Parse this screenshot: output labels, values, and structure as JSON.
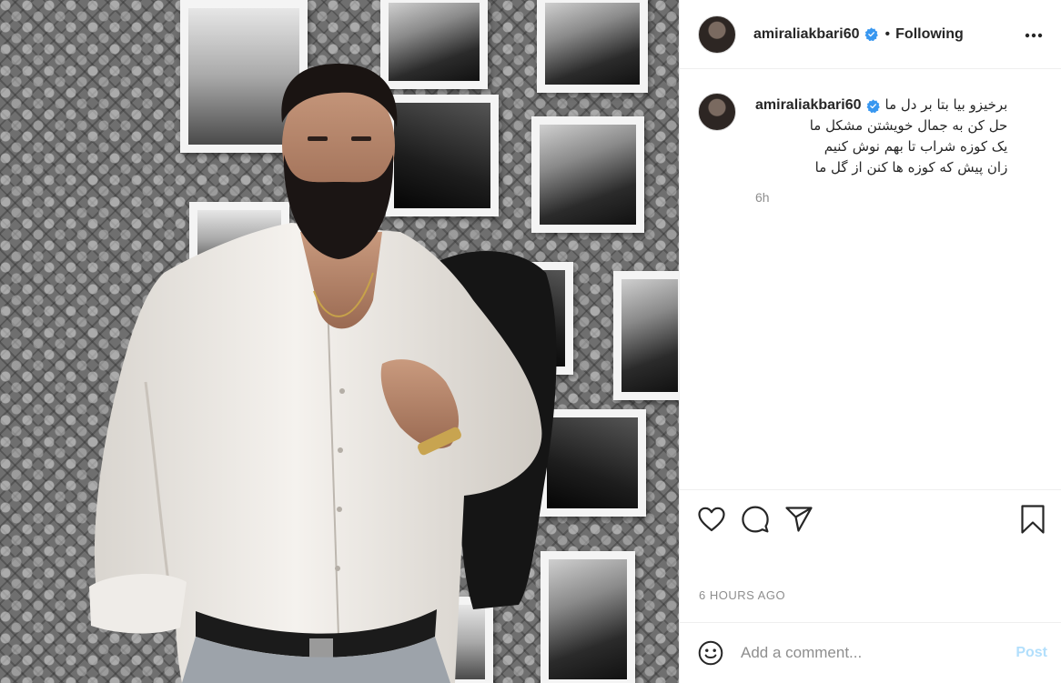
{
  "post": {
    "username": "amiraliakbari60",
    "follow_state": "Following",
    "separator": "•",
    "caption": {
      "username": "amiraliakbari60",
      "lines": [
        "برخیزو بیا بتا بر دل ما",
        "حل کن به جمال خویشتن مشکل ما",
        "یک کوزه شراب تا بهم نوش کنیم",
        "زان پیش که کوزه ها کنن از گل ما"
      ],
      "age": "6h"
    },
    "timestamp": "6 HOURS AGO",
    "comment": {
      "placeholder": "Add a comment...",
      "value": "",
      "post_label": "Post"
    }
  },
  "icons": {
    "verified": "verified-badge-icon",
    "more": "more-options-icon",
    "like": "heart-icon",
    "comment": "comment-bubble-icon",
    "share": "paper-plane-icon",
    "save": "bookmark-icon",
    "emoji": "smiley-icon"
  },
  "colors": {
    "verified": "#3897f0",
    "post_button": "#b2dffc",
    "secondary_text": "#8e8e8e",
    "primary_text": "#262626"
  }
}
